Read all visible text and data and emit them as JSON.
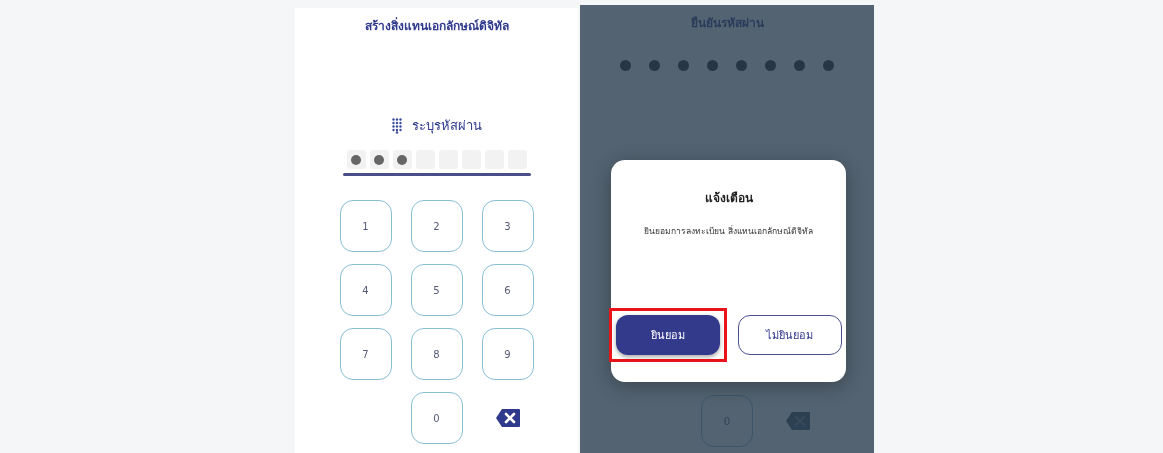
{
  "create_screen": {
    "title": "สร้างสิ่งแทนเอกลักษณ์ดิจิทัล",
    "pin_label": "ระบุรหัสผ่าน",
    "pin_slots": [
      {
        "filled": true
      },
      {
        "filled": true
      },
      {
        "filled": true
      },
      {
        "filled": false
      },
      {
        "filled": false
      },
      {
        "filled": false
      },
      {
        "filled": false
      },
      {
        "filled": false
      }
    ],
    "keys": [
      "1",
      "2",
      "3",
      "4",
      "5",
      "6",
      "7",
      "8",
      "9",
      "0"
    ]
  },
  "confirm_screen": {
    "title": "ยืนยันรหัสผ่าน",
    "pin_slots": [
      {
        "filled": true
      },
      {
        "filled": true
      },
      {
        "filled": true
      },
      {
        "filled": true
      },
      {
        "filled": true
      },
      {
        "filled": true
      },
      {
        "filled": true
      },
      {
        "filled": true
      }
    ],
    "keys": [
      "0"
    ]
  },
  "dialog": {
    "title": "แจ้งเตือน",
    "message": "ยินยอมการลงทะเบียน สิ่งแทนเอกลักษณ์ดิจิทัล",
    "buttons": [
      {
        "label": "ยินยอม",
        "kind": "primary",
        "highlighted": true
      },
      {
        "label": "ไม่ยินยอม",
        "kind": "secondary",
        "highlighted": false
      }
    ]
  }
}
